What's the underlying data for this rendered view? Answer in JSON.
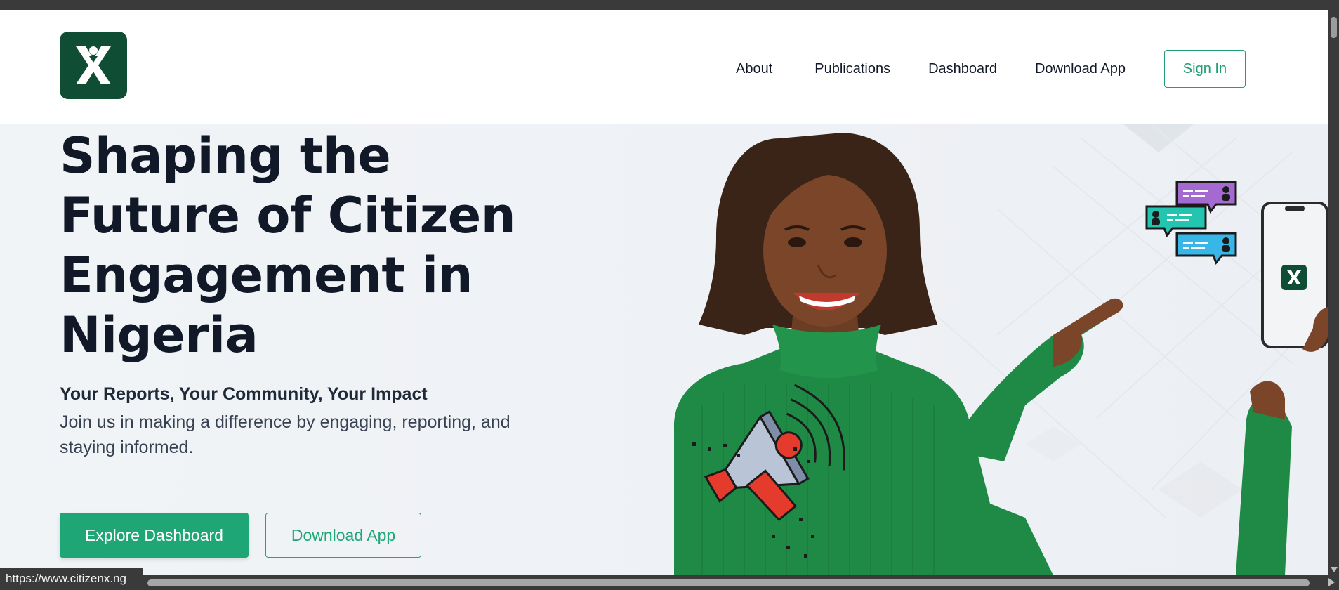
{
  "brand": {
    "logo_icon": "citizenx-logo-icon",
    "color": "#0f4d34"
  },
  "nav": {
    "items": [
      "About",
      "Publications",
      "Dashboard",
      "Download App"
    ],
    "signin_label": "Sign In"
  },
  "hero": {
    "title": "Shaping the Future of Citizen Engagement in Nigeria",
    "tagline": "Your Reports, Your Community, Your Impact",
    "text": "Join us in making a difference by engaging, reporting, and staying informed.",
    "primary_cta": "Explore Dashboard",
    "secondary_cta": "Download App",
    "art_icons": [
      "smiling-woman-pointing-image",
      "megaphone-icon",
      "chat-bubbles-icon",
      "phone-mockup-icon"
    ]
  },
  "status": {
    "url": "https://www.citizenx.ng"
  },
  "colors": {
    "accent": "#1fa676",
    "text": "#111827",
    "chrome": "#3a3a3a"
  }
}
